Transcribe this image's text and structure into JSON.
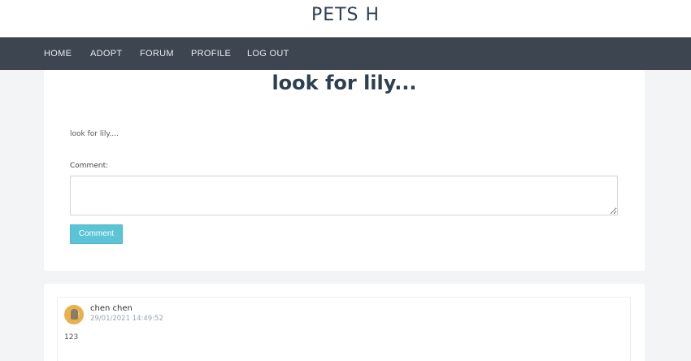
{
  "site": {
    "title": "PETS H"
  },
  "nav": {
    "items": [
      {
        "label": "HOME"
      },
      {
        "label": "ADOPT"
      },
      {
        "label": "FORUM"
      },
      {
        "label": "PROFILE"
      },
      {
        "label": "LOG OUT"
      }
    ]
  },
  "post": {
    "title": "look for lily...",
    "body": "look for lily....",
    "comment_label": "Comment:",
    "comment_value": "",
    "comment_button": "Comment"
  },
  "comments": [
    {
      "author": "chen chen",
      "date": "29/01/2021 14:49:52",
      "text": "123",
      "avatar_icon": "user-avatar-cat"
    }
  ],
  "colors": {
    "nav_bg": "#3c4550",
    "accent_button": "#5bc4d6",
    "title_text": "#2e3f52"
  }
}
